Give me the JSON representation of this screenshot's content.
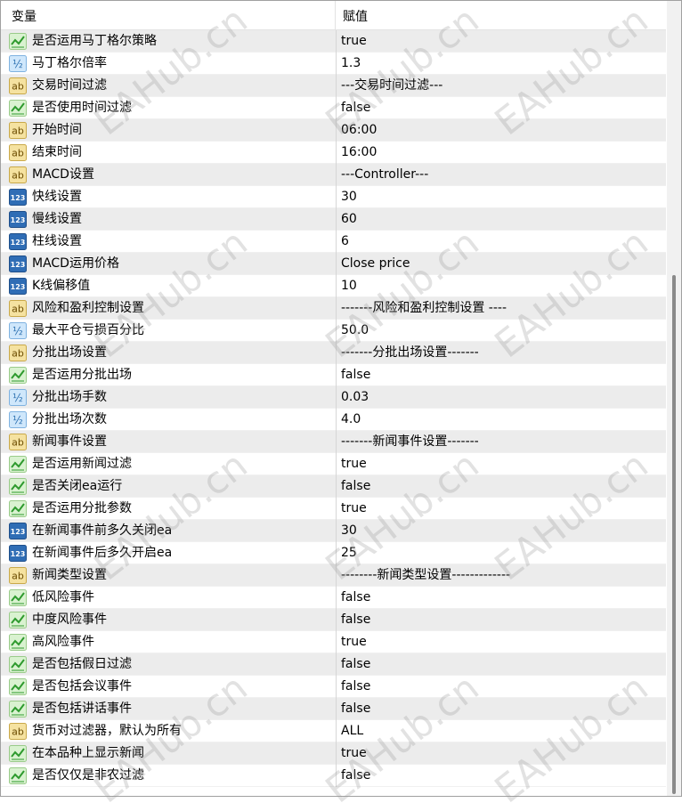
{
  "header": {
    "col_name": "变量",
    "col_value": "赋值"
  },
  "watermark_text": "EAHub.cn",
  "rows": [
    {
      "icon": "bool",
      "name": "是否运用马丁格尔策略",
      "value": "true"
    },
    {
      "icon": "double",
      "name": "马丁格尔倍率",
      "value": "1.3"
    },
    {
      "icon": "string",
      "name": "交易时间过滤",
      "value": "---交易时间过滤---"
    },
    {
      "icon": "bool",
      "name": "是否使用时间过滤",
      "value": "false"
    },
    {
      "icon": "string",
      "name": "开始时间",
      "value": "06:00"
    },
    {
      "icon": "string",
      "name": "结束时间",
      "value": "16:00"
    },
    {
      "icon": "string",
      "name": "MACD设置",
      "value": "---Controller---"
    },
    {
      "icon": "int",
      "name": "快线设置",
      "value": "30"
    },
    {
      "icon": "int",
      "name": "慢线设置",
      "value": "60"
    },
    {
      "icon": "int",
      "name": "柱线设置",
      "value": "6"
    },
    {
      "icon": "int",
      "name": "MACD运用价格",
      "value": "Close price"
    },
    {
      "icon": "int",
      "name": "K线偏移值",
      "value": "10"
    },
    {
      "icon": "string",
      "name": "风险和盈利控制设置",
      "value": "-------风险和盈利控制设置 ----"
    },
    {
      "icon": "double",
      "name": "最大平仓亏损百分比",
      "value": "50.0"
    },
    {
      "icon": "string",
      "name": "分批出场设置",
      "value": "-------分批出场设置-------"
    },
    {
      "icon": "bool",
      "name": "是否运用分批出场",
      "value": "false"
    },
    {
      "icon": "double",
      "name": "分批出场手数",
      "value": "0.03"
    },
    {
      "icon": "double",
      "name": "分批出场次数",
      "value": "4.0"
    },
    {
      "icon": "string",
      "name": "新闻事件设置",
      "value": "-------新闻事件设置-------"
    },
    {
      "icon": "bool",
      "name": "是否运用新闻过滤",
      "value": "true"
    },
    {
      "icon": "bool",
      "name": "是否关闭ea运行",
      "value": "false"
    },
    {
      "icon": "bool",
      "name": "是否运用分批参数",
      "value": "true"
    },
    {
      "icon": "int",
      "name": "在新闻事件前多久关闭ea",
      "value": "30"
    },
    {
      "icon": "int",
      "name": "在新闻事件后多久开启ea",
      "value": "25"
    },
    {
      "icon": "string",
      "name": "新闻类型设置",
      "value": "--------新闻类型设置-------------"
    },
    {
      "icon": "bool",
      "name": "低风险事件",
      "value": "false"
    },
    {
      "icon": "bool",
      "name": "中度风险事件",
      "value": "false"
    },
    {
      "icon": "bool",
      "name": "高风险事件",
      "value": "true"
    },
    {
      "icon": "bool",
      "name": "是否包括假日过滤",
      "value": "false"
    },
    {
      "icon": "bool",
      "name": "是否包括会议事件",
      "value": "false"
    },
    {
      "icon": "bool",
      "name": "是否包括讲话事件",
      "value": "false"
    },
    {
      "icon": "string",
      "name": "货币对过滤器，默认为所有",
      "value": "ALL"
    },
    {
      "icon": "bool",
      "name": "在本品种上显示新闻",
      "value": "true"
    },
    {
      "icon": "bool",
      "name": "是否仅仅是非农过滤",
      "value": "false"
    }
  ],
  "icon_labels": {
    "string": "ab",
    "double": "½",
    "int": "123"
  },
  "colors": {
    "bool_bg": "#d9f2d0",
    "bool_stroke": "#2e9a2e",
    "string_bg": "#f5e2a0",
    "string_text": "#6b4b00",
    "double_bg": "#cfe7fb",
    "double_text": "#2a6fb0",
    "int_bg": "#2f6db5",
    "int_text": "#ffffff"
  }
}
